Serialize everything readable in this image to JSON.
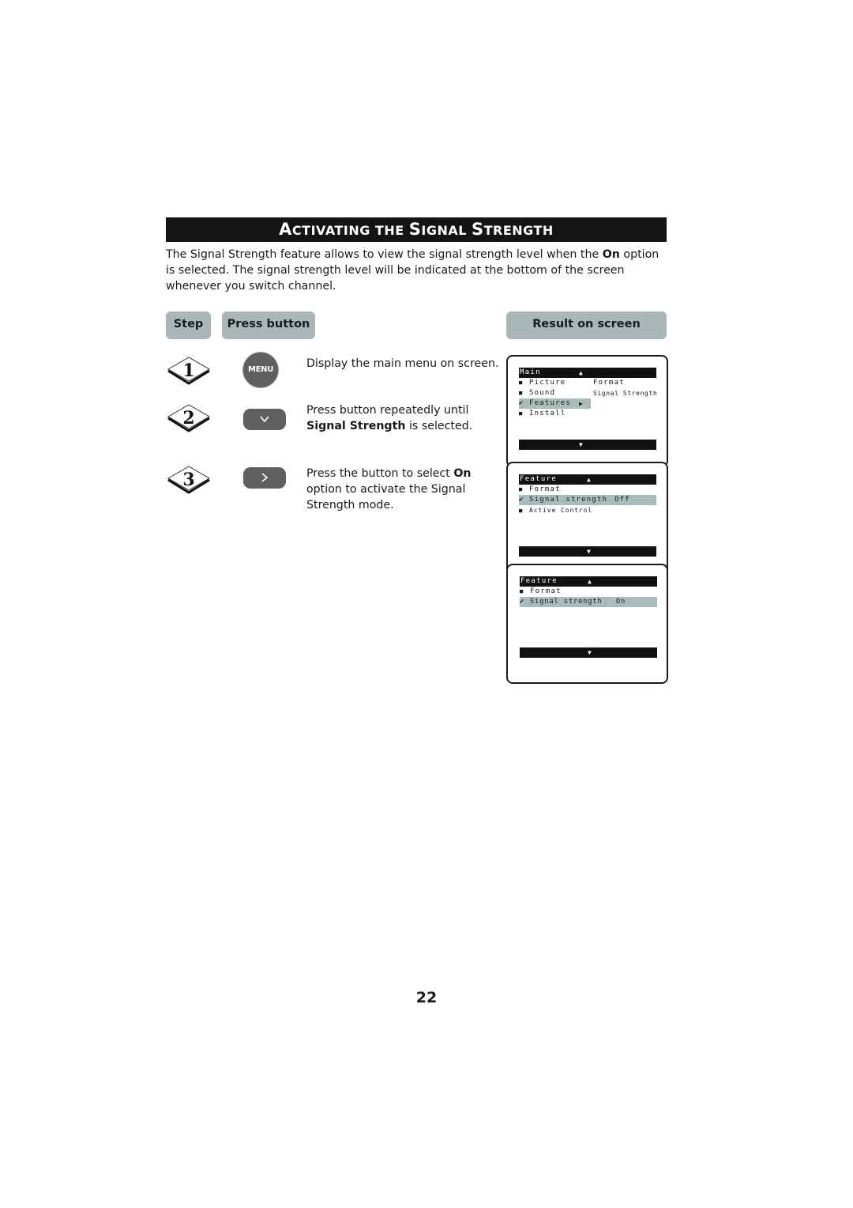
{
  "title": {
    "part1_cap": "A",
    "part1_rest": "CTIVATING THE ",
    "part2_cap": "S",
    "part2_rest": "IGNAL ",
    "part3_cap": "S",
    "part3_rest": "TRENGTH"
  },
  "intro": {
    "before": "The Signal Strength feature allows to view the signal strength level when the ",
    "bold": "On",
    "after": " option is selected. The signal strength level will be indicated at the bottom of the screen whenever you switch channel."
  },
  "headers": {
    "step": "Step",
    "press_button": "Press button",
    "result": "Result on screen"
  },
  "steps": [
    {
      "number": "1",
      "button": "MENU",
      "button_icon": "menu-button",
      "text_before": "Display the main menu on screen.",
      "bold": "",
      "text_after": ""
    },
    {
      "number": "2",
      "button": "",
      "button_icon": "chevron-down-icon",
      "text_before": "Press button repeatedly until ",
      "bold": "Signal Strength",
      "text_after": " is selected."
    },
    {
      "number": "3",
      "button": "",
      "button_icon": "chevron-right-icon",
      "text_before": "Press the button to select ",
      "bold": "On",
      "text_after": " option to activate the Signal Strength mode."
    }
  ],
  "screens": [
    {
      "header": "Main",
      "items": [
        {
          "marker": "■",
          "label": "Picture",
          "value": ""
        },
        {
          "marker": "■",
          "label": "Sound",
          "value": ""
        },
        {
          "marker": "✔",
          "label": "Features",
          "value": "▶",
          "selected": true
        },
        {
          "marker": "■",
          "label": "Install",
          "value": ""
        }
      ],
      "submenu": [
        "Format",
        "Signal Strength"
      ]
    },
    {
      "header": "Feature",
      "items": [
        {
          "marker": "■",
          "label": "Format",
          "value": ""
        },
        {
          "marker": "✔",
          "label": "Signal strength",
          "value": "Off",
          "selected": true
        },
        {
          "marker": "■",
          "label": "Active Control",
          "value": ""
        }
      ]
    },
    {
      "header": "Feature",
      "items": [
        {
          "marker": "■",
          "label": "Format",
          "value": ""
        },
        {
          "marker": "✔",
          "label": "Signal strength",
          "value": "On",
          "selected": true
        }
      ]
    }
  ],
  "osd_arrows": {
    "up": "▲",
    "down": "▼"
  },
  "page_number": "22"
}
